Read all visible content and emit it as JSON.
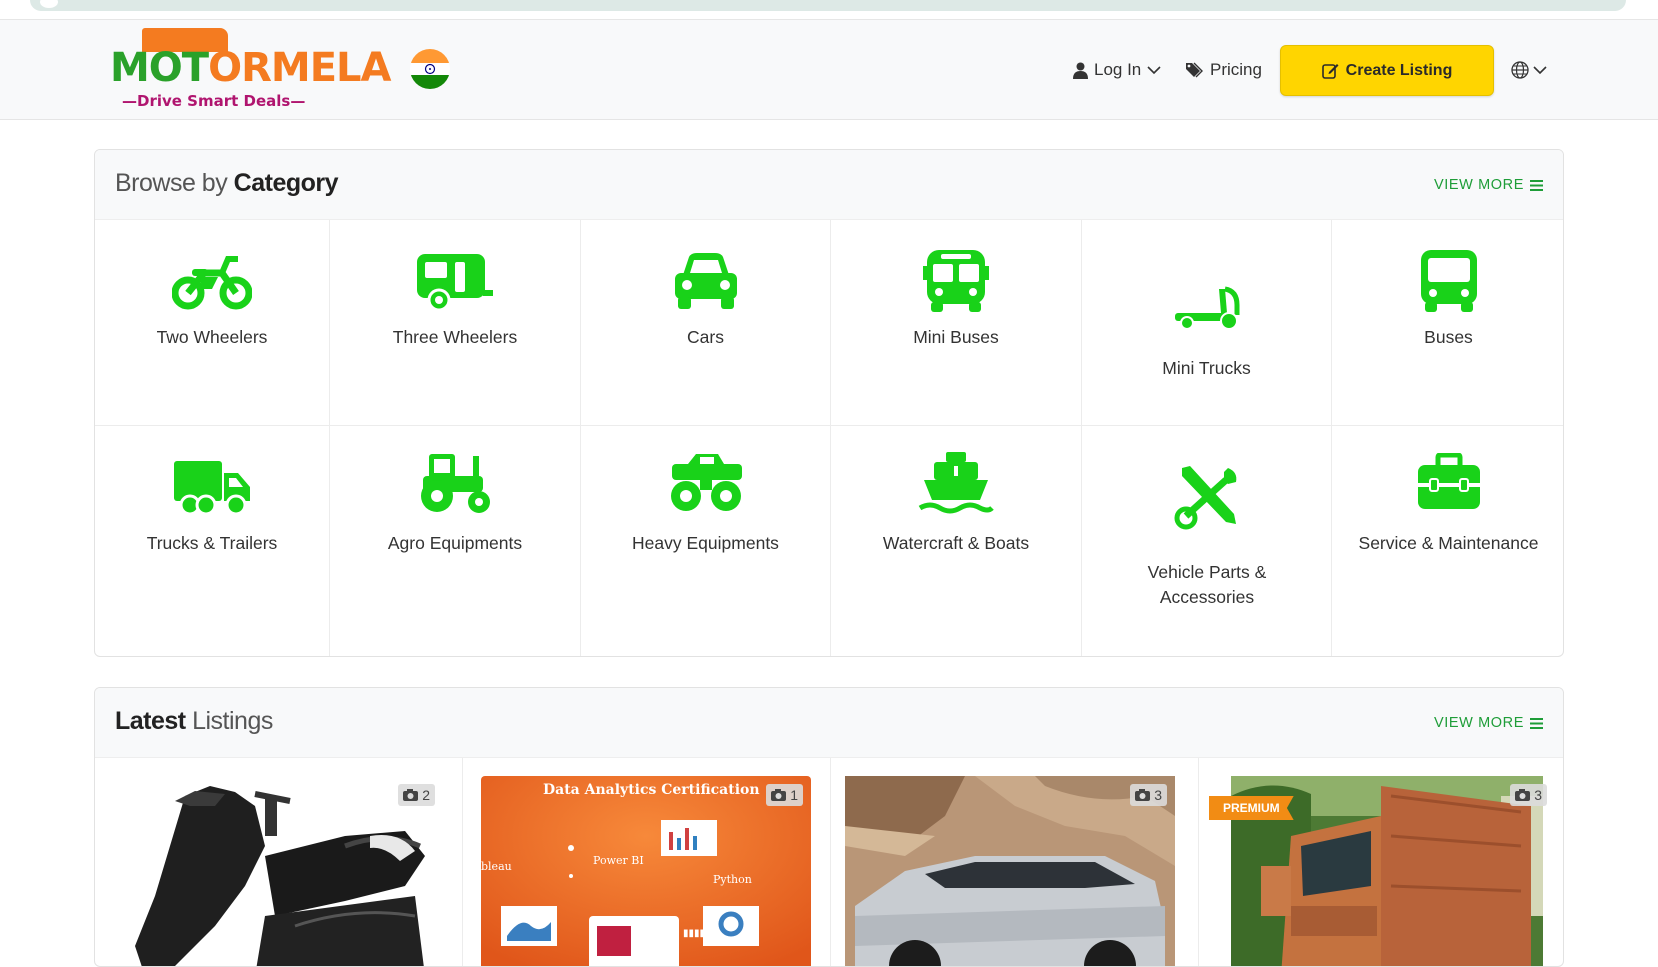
{
  "brand": {
    "name_part1": "MOT",
    "name_part2": "OR",
    "name_part3": "MELA",
    "tagline": "—Drive Smart Deals—"
  },
  "nav": {
    "login": "Log In",
    "pricing": "Pricing",
    "create_listing": "Create Listing"
  },
  "browse": {
    "title_light": "Browse by",
    "title_bold": "Category",
    "view_more": "VIEW MORE",
    "categories": [
      {
        "label": "Two Wheelers",
        "icon": "motorcycle-icon"
      },
      {
        "label": "Three Wheelers",
        "icon": "auto-rickshaw-icon"
      },
      {
        "label": "Cars",
        "icon": "car-icon"
      },
      {
        "label": "Mini Buses",
        "icon": "bus-front-icon"
      },
      {
        "label": "Mini Trucks",
        "icon": "dolly-icon"
      },
      {
        "label": "Buses",
        "icon": "bus-icon"
      },
      {
        "label": "Trucks & Trailers",
        "icon": "truck-icon"
      },
      {
        "label": "Agro Equipments",
        "icon": "tractor-icon"
      },
      {
        "label": "Heavy Equipments",
        "icon": "monster-truck-icon"
      },
      {
        "label": "Watercraft & Boats",
        "icon": "ship-icon"
      },
      {
        "label": "Vehicle Parts & Accessories",
        "icon": "tools-icon"
      },
      {
        "label": "Service & Maintenance",
        "icon": "toolbox-icon"
      }
    ]
  },
  "latest": {
    "title_bold": "Latest",
    "title_light": "Listings",
    "view_more": "VIEW MORE",
    "items": [
      {
        "photos": "2",
        "image": "black-scooter"
      },
      {
        "photos": "1",
        "image": "data-analytics-poster",
        "poster_title": "Data Analytics Certification",
        "poster_words": [
          "Power BI",
          "Python",
          "bleau"
        ]
      },
      {
        "photos": "3",
        "image": "silver-mpv-car"
      },
      {
        "photos": "3",
        "image": "orange-truck",
        "badge": "PREMIUM"
      }
    ]
  },
  "colors": {
    "accent_green": "#19d219",
    "link_green": "#1e9d38",
    "cta_yellow": "#ffd500"
  }
}
